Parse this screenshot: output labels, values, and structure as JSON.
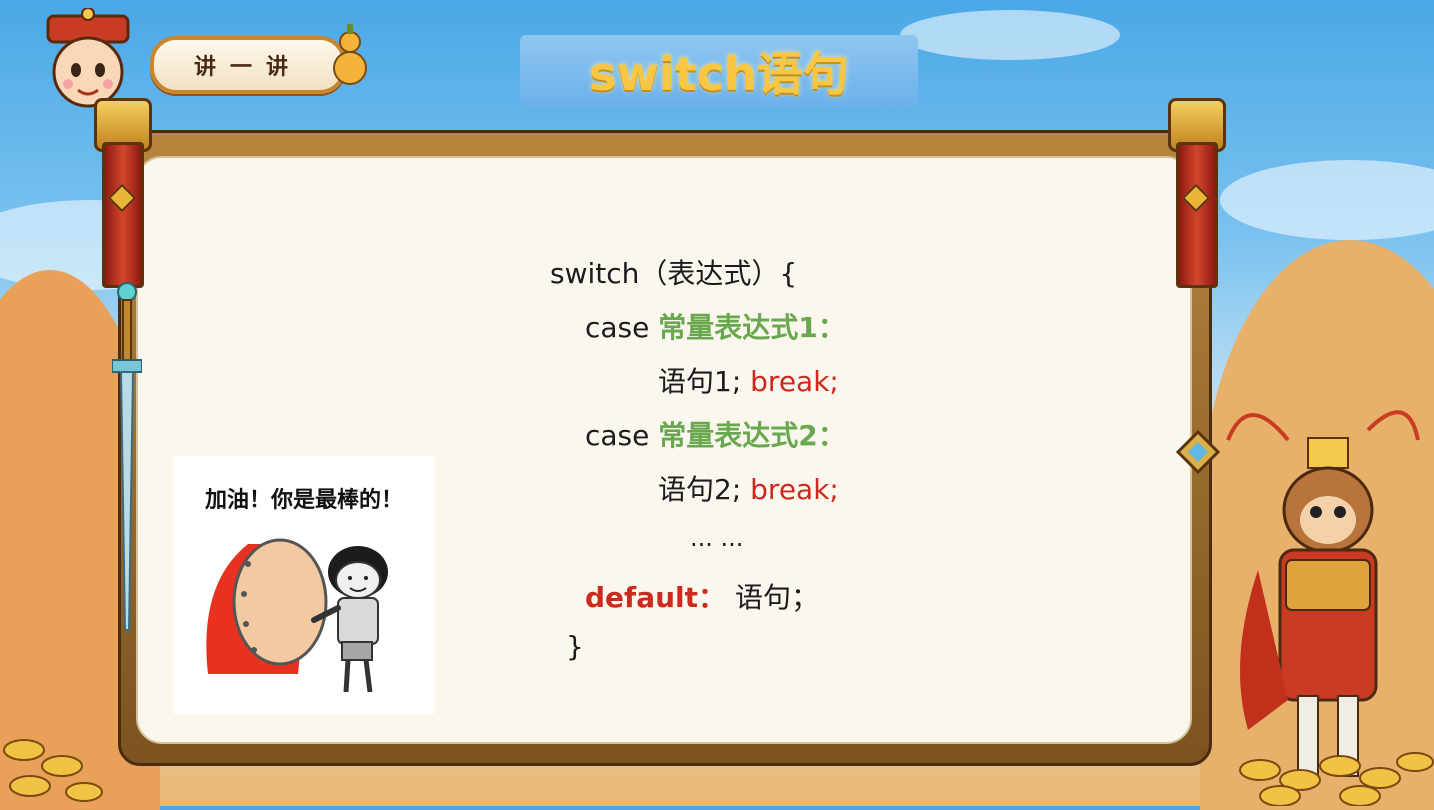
{
  "header": {
    "badge_label": "讲一讲",
    "title": "switch语句"
  },
  "code": {
    "line1": "switch（表达式）{",
    "case1_kw": "case",
    "case1_expr": "常量表达式1：",
    "stmt1_text": "语句1;",
    "stmt1_break": "break;",
    "case2_kw": "case",
    "case2_expr": "常量表达式2：",
    "stmt2_text": "语句2;",
    "stmt2_break": "break;",
    "ellipsis": "... ...",
    "default_kw": "default：",
    "default_stmt": "语句；",
    "close": "}"
  },
  "meme": {
    "caption": "加油！你是最棒的！"
  },
  "colors": {
    "green": "#6aa84f",
    "red": "#cc2a1e",
    "title_gold": "#f7c643"
  }
}
